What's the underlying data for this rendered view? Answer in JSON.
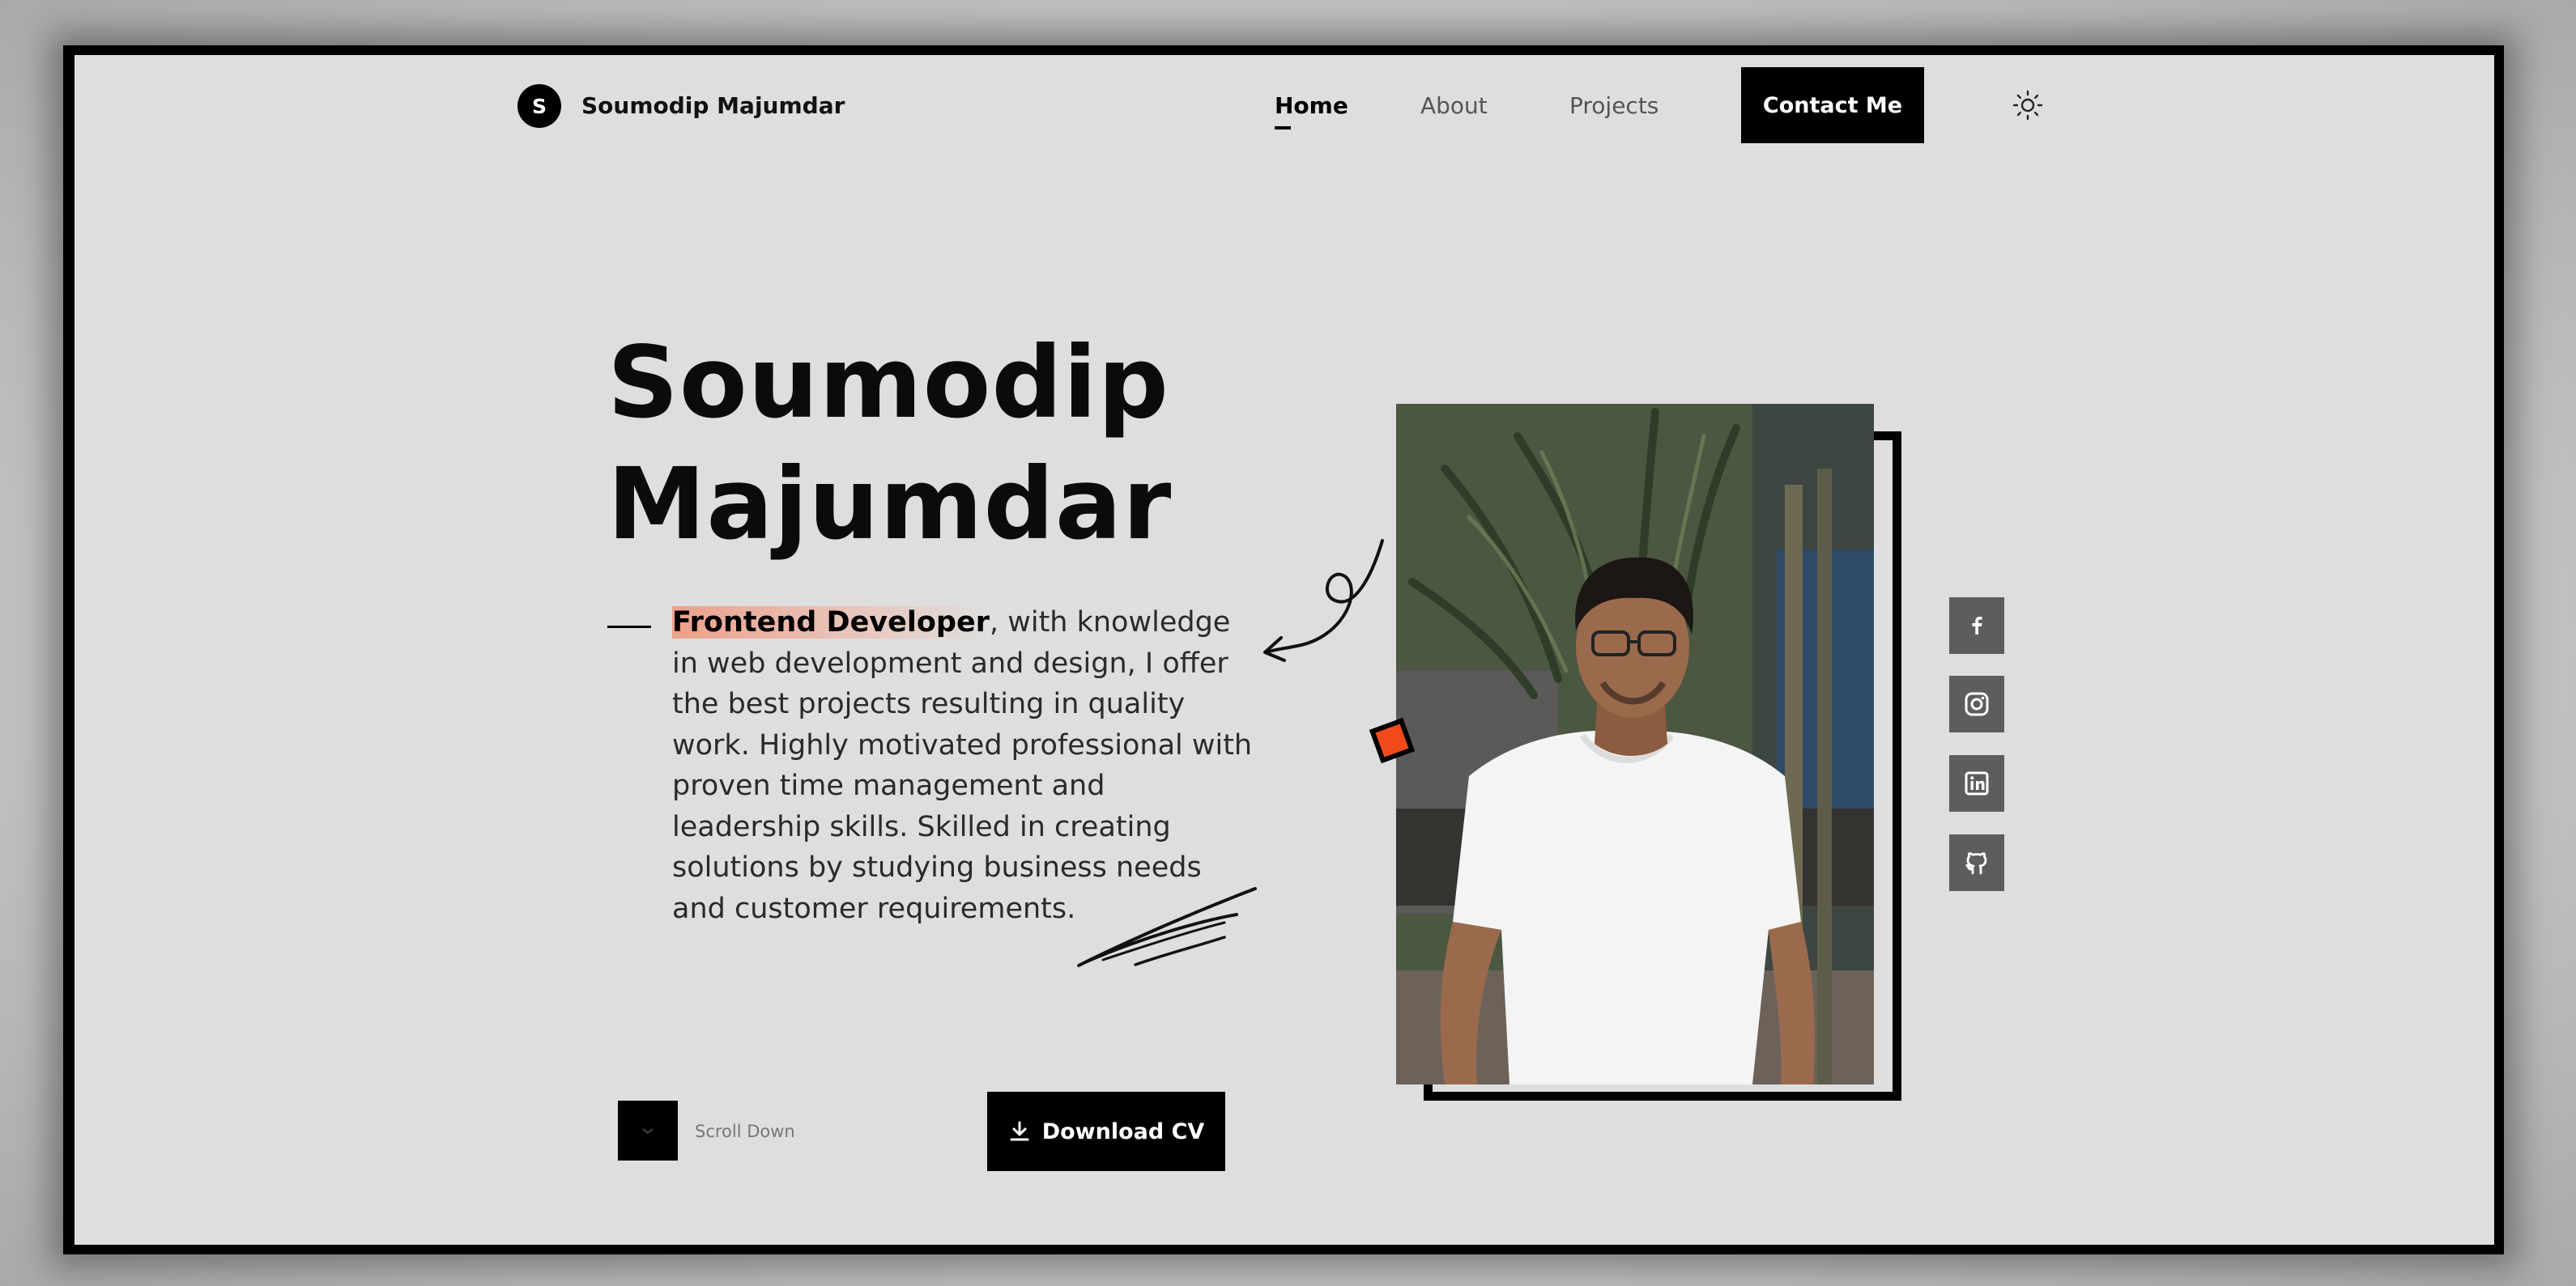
{
  "nav": {
    "logo_letter": "S",
    "brand_name": "Soumodip Majumdar",
    "links": [
      {
        "label": "Home",
        "active": true
      },
      {
        "label": "About",
        "active": false
      },
      {
        "label": "Projects",
        "active": false
      }
    ],
    "contact_label": "Contact Me",
    "theme_icon": "sun-icon"
  },
  "hero": {
    "title_line1": "Soumodip",
    "title_line2": "Majumdar",
    "role": "Frontend Developer",
    "description": ", with knowledge in web development and design, I offer the best projects resulting in quality work. Highly motivated professional with proven time management and leadership skills. Skilled in creating solutions by studying business needs and customer requirements.",
    "scroll_label": "Scroll Down",
    "download_label": "Download CV"
  },
  "social": [
    {
      "icon": "facebook-icon"
    },
    {
      "icon": "instagram-icon"
    },
    {
      "icon": "linkedin-icon"
    },
    {
      "icon": "github-icon"
    }
  ],
  "colors": {
    "page_bg": "#dedede",
    "accent": "#f04a1a",
    "highlight": "#f08c6e",
    "dark": "#000000",
    "social_bg": "#5d5d5d"
  }
}
